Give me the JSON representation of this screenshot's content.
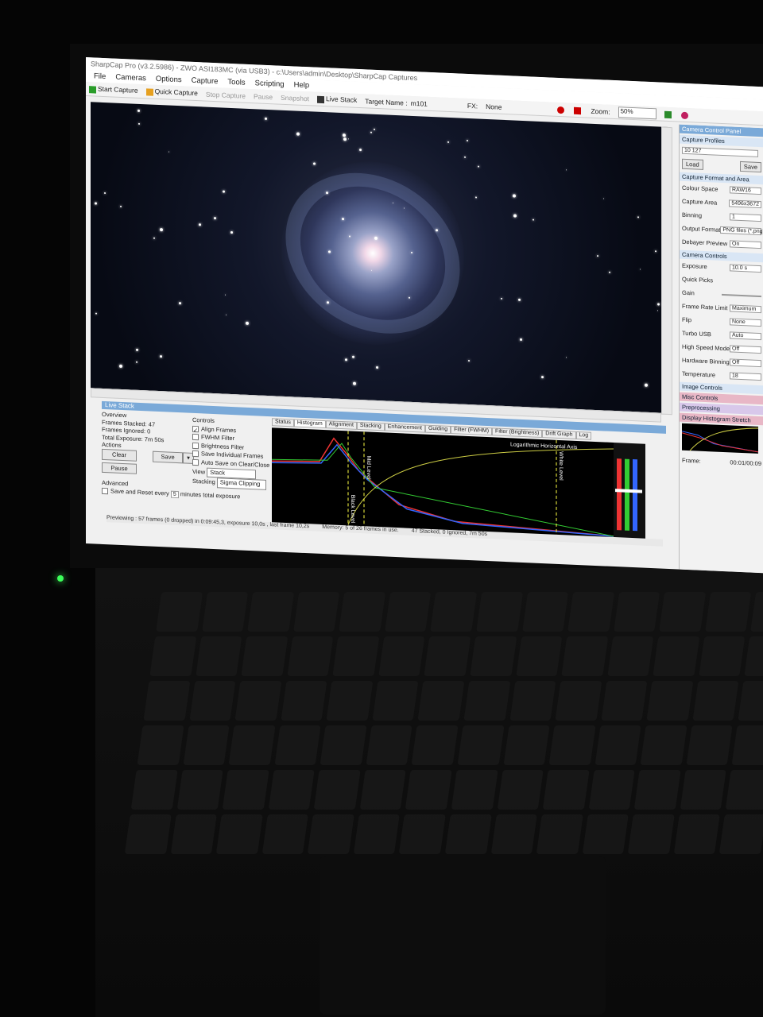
{
  "window": {
    "title": "SharpCap Pro (v3.2.5986) - ZWO ASI183MC (via USB3) - c:\\Users\\admin\\Desktop\\SharpCap Captures"
  },
  "menu": [
    "File",
    "Cameras",
    "Options",
    "Capture",
    "Tools",
    "Scripting",
    "Help"
  ],
  "toolbar": {
    "start_capture": "Start Capture",
    "quick_capture": "Quick Capture",
    "stop_capture": "Stop Capture",
    "pause": "Pause",
    "snapshot": "Snapshot",
    "live_stack": "Live Stack",
    "target_label": "Target Name :",
    "target_value": "m101",
    "fx_label": "FX:",
    "fx_value": "None",
    "zoom_label": "Zoom:",
    "zoom_value": "50%"
  },
  "live_stack": {
    "title": "Live Stack",
    "overview": "Overview",
    "frames_stacked": "Frames Stacked: 47",
    "frames_ignored": "Frames Ignored: 0",
    "total_exposure": "Total Exposure: 7m 50s",
    "actions": "Actions",
    "clear": "Clear",
    "save": "Save",
    "pause": "Pause",
    "advanced": "Advanced",
    "save_reset": "Save and Reset every",
    "reset_minutes": "5",
    "minutes_text": "minutes total exposure",
    "controls": "Controls",
    "align_frames": "Align Frames",
    "fwhm_filter": "FWHM Filter",
    "brightness_filter": "Brightness Filter",
    "save_individual": "Save Individual Frames",
    "auto_save": "Auto Save on Clear/Close",
    "view_label": "View",
    "view_value": "Stack",
    "stacking_label": "Stacking",
    "stacking_value": "Sigma Clipping"
  },
  "tabs": [
    "Status",
    "Histogram",
    "Alignment",
    "Stacking",
    "Enhancement",
    "Guiding",
    "Filter (FWHM)",
    "Filter (Brightness)",
    "Drift Graph",
    "Log"
  ],
  "histogram": {
    "log_axis": "Logarithmic Horizontal Axis",
    "black_level": "Black Level",
    "mid_level": "Mid Level",
    "white_level": "White Level"
  },
  "status": {
    "previewing": "Previewing : 57 frames (0 dropped) in 0:09:45,3, exposure 10,0s , last frame 10,2s",
    "memory": "Memory: 5 of 26 frames in use.",
    "stacked": "47 Stacked, 0 Ignored, 7m 50s"
  },
  "ccp": {
    "title": "Camera Control Panel",
    "capture_profiles": "Capture Profiles",
    "profile_value": "10 127",
    "load": "Load",
    "save": "Save",
    "capture_format": "Capture Format and Area",
    "colour_space_label": "Colour Space",
    "colour_space_value": "RAW16",
    "capture_area_label": "Capture Area",
    "capture_area_value": "5496x3672",
    "binning_label": "Binning",
    "binning_value": "1",
    "output_format_label": "Output Format",
    "output_format_value": "PNG files (*.png)",
    "debayer_label": "Debayer Preview",
    "debayer_value": "On",
    "camera_controls": "Camera Controls",
    "exposure_label": "Exposure",
    "exposure_value": "10.0 s",
    "quick_picks": "Quick Picks",
    "gain_label": "Gain",
    "frame_rate_label": "Frame Rate Limit",
    "frame_rate_value": "Maximum",
    "flip_label": "Flip",
    "flip_value": "None",
    "turbo_label": "Turbo USB",
    "turbo_value": "Auto",
    "hsm_label": "High Speed Mode",
    "hsm_value": "Off",
    "hw_bin_label": "Hardware Binning",
    "hw_bin_value": "Off",
    "temp_label": "Temperature",
    "temp_value": "18",
    "image_controls": "Image Controls",
    "misc_controls": "Misc Controls",
    "preprocessing": "Preprocessing",
    "display_stretch": "Display Histogram Stretch",
    "frame_label": "Frame:",
    "frame_time": "00:01/00:09"
  },
  "colors": {
    "titlebar_blue": "#7aa9d8",
    "pink_section": "#e8b7c6",
    "led_green": "#3cff5a"
  }
}
